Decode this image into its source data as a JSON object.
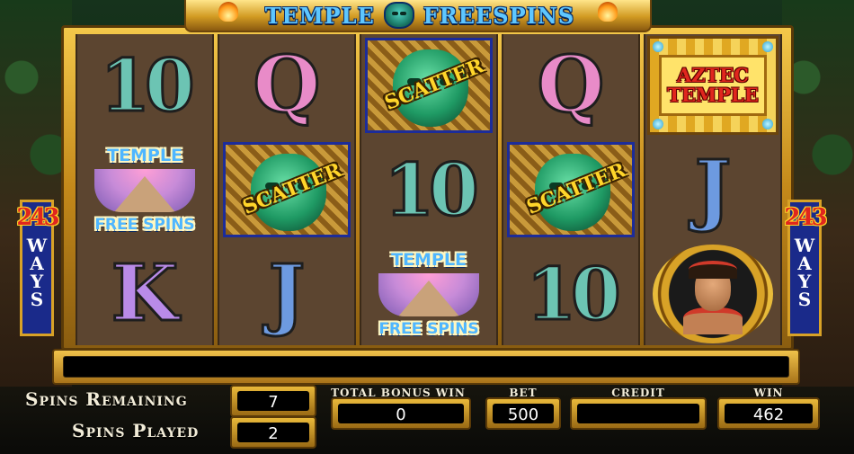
{
  "banner": {
    "title_left": "TEMPLE",
    "title_right": "FREESPINS",
    "icon": "jade-mask-icon"
  },
  "reels": [
    [
      {
        "type": "letter",
        "text": "10",
        "cls": "sym-10"
      },
      {
        "type": "temple_freespins",
        "line1": "TEMPLE",
        "line2": "FREE SPINS"
      },
      {
        "type": "letter",
        "text": "K",
        "cls": "sym-K"
      }
    ],
    [
      {
        "type": "letter",
        "text": "Q",
        "cls": "sym-Q"
      },
      {
        "type": "scatter",
        "text": "SCATTER"
      },
      {
        "type": "letter",
        "text": "J",
        "cls": "sym-J"
      }
    ],
    [
      {
        "type": "scatter",
        "text": "SCATTER"
      },
      {
        "type": "letter",
        "text": "10",
        "cls": "sym-10"
      },
      {
        "type": "temple_freespins",
        "line1": "TEMPLE",
        "line2": "FREE SPINS"
      }
    ],
    [
      {
        "type": "letter",
        "text": "Q",
        "cls": "sym-Q"
      },
      {
        "type": "scatter",
        "text": "SCATTER"
      },
      {
        "type": "letter",
        "text": "10",
        "cls": "sym-10"
      }
    ],
    [
      {
        "type": "aztec_temple",
        "line1": "AZTEC",
        "line2": "TEMPLE"
      },
      {
        "type": "letter",
        "text": "J",
        "cls": "sym-J"
      },
      {
        "type": "warrior"
      }
    ]
  ],
  "ways": {
    "number": "243",
    "word": "WAYS"
  },
  "message_bar": {
    "text": ""
  },
  "hud": {
    "spins_remaining_label": "Spins Remaining",
    "spins_remaining": "7",
    "spins_played_label": "Spins Played",
    "spins_played": "2",
    "total_bonus_win_label": "TOTAL BONUS WIN",
    "total_bonus_win": "0",
    "bet_label": "BET",
    "bet": "500",
    "credit_label": "CREDIT",
    "credit": "",
    "win_label": "WIN",
    "win": "462"
  },
  "colors": {
    "gold": "#d8a227",
    "scatter_border": "#1c2c9a",
    "title_blue": "#5ec7ff",
    "ways_red": "#e0261e"
  }
}
